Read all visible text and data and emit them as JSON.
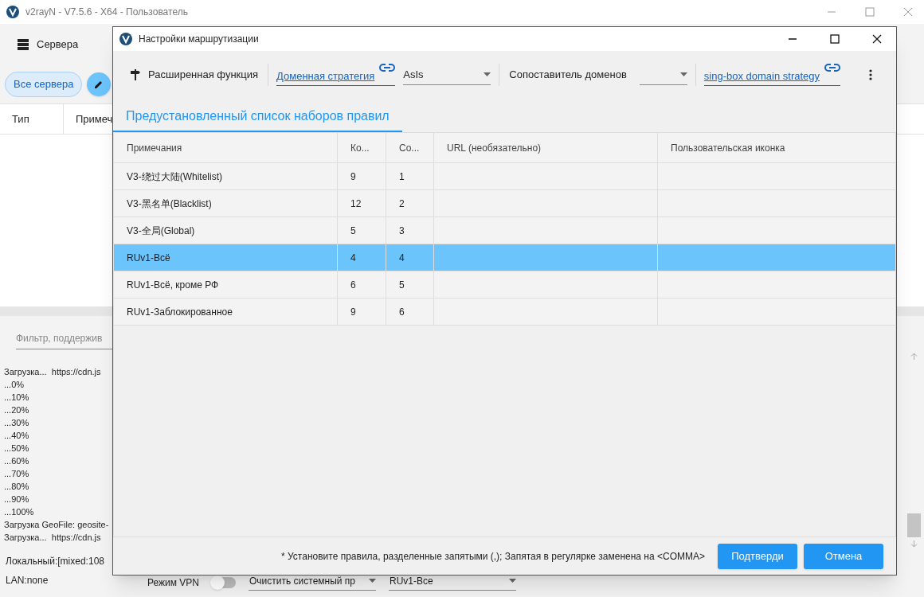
{
  "main_window": {
    "title": "v2rayN - V7.5.6 - X64 - Пользователь",
    "toolbar": [
      {
        "label": "Сервера"
      }
    ],
    "filter_chip": {
      "label": "Все сервера",
      "selected": true
    },
    "table_columns": [
      "Тип",
      "Примеч"
    ],
    "filter": {
      "placeholder": "Фильтр, поддержив"
    },
    "log": [
      "Загрузка...  https://cdn.js",
      "...0%",
      "...10%",
      "...20%",
      "...30%",
      "...40%",
      "...50%",
      "...60%",
      "...70%",
      "...80%",
      "...90%",
      "...100%",
      "Загрузка GeoFile: geosite-",
      "Загрузка...  https://cdn.js"
    ],
    "status": {
      "local": "Локальный:[mixed:108",
      "lan": "LAN:none",
      "vpn_label": "Режим VPN",
      "vpn_on": false,
      "proxy_mode": "Очистить системный пр",
      "routing": "RUv1-Все"
    }
  },
  "dialog": {
    "title": "Настройки маршрутизации",
    "toolbar": {
      "advanced": "Расширенная функция",
      "domain_strategy_link": "Доменная стратегия",
      "domain_strategy": "AsIs",
      "matcher_label": "Сопоставитель доменов",
      "singbox_link": "sing-box domain strategy"
    },
    "tabs": [
      {
        "label": "Предустановленный список наборов правил",
        "selected": true
      }
    ],
    "table": {
      "columns": [
        "Примечания",
        "Ко...",
        "Со...",
        "URL (необязательно)",
        "Пользовательская иконка"
      ],
      "rows": [
        {
          "cells": [
            "V3-绕过大陆(Whitelist)",
            "9",
            "1"
          ],
          "selected": false
        },
        {
          "cells": [
            "V3-黑名单(Blacklist)",
            "12",
            "2"
          ],
          "selected": false
        },
        {
          "cells": [
            "V3-全局(Global)",
            "5",
            "3"
          ],
          "selected": false
        },
        {
          "cells": [
            "RUv1-Всё",
            "4",
            "4"
          ],
          "selected": true
        },
        {
          "cells": [
            "RUv1-Всё, кроме РФ",
            "6",
            "5"
          ],
          "selected": false
        },
        {
          "cells": [
            "RUv1-Заблокированное",
            "9",
            "6"
          ],
          "selected": false
        }
      ]
    },
    "note": "* Установите правила, разделенные запятыми (,); Запятая в регулярке заменена на <COMMA>",
    "buttons": [
      {
        "label": "Подтверди",
        "kind": "primary"
      },
      {
        "label": "Отмена",
        "kind": "primary"
      }
    ]
  }
}
